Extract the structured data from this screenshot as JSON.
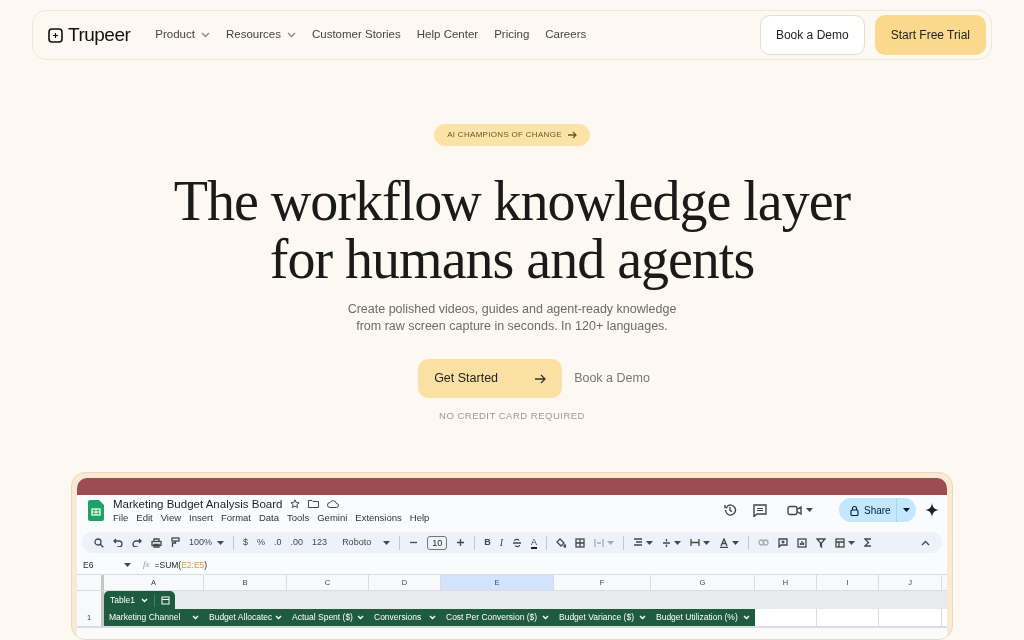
{
  "nav": {
    "logo": "Trupeer",
    "menu": [
      {
        "label": "Product",
        "dropdown": true
      },
      {
        "label": "Resources",
        "dropdown": true
      },
      {
        "label": "Customer Stories",
        "dropdown": false
      },
      {
        "label": "Help Center",
        "dropdown": false
      },
      {
        "label": "Pricing",
        "dropdown": false
      },
      {
        "label": "Careers",
        "dropdown": false
      }
    ],
    "demo_button": "Book a Demo",
    "trial_button": "Start Free Trial"
  },
  "hero": {
    "badge": "AI CHAMPIONS OF CHANGE",
    "headline": [
      "The workflow knowledge layer",
      "for humans and agents"
    ],
    "subtitle": [
      "Create polished videos, guides and agent-ready knowledge",
      "from raw screen capture in seconds. In 120+ languages."
    ],
    "primary_button": "Get Started",
    "secondary_link": "Book a Demo",
    "note": "NO CREDIT CARD REQUIRED"
  },
  "sheet": {
    "title": "Marketing Budget Analysis Board",
    "menus": [
      "File",
      "Edit",
      "View",
      "Insert",
      "Format",
      "Data",
      "Tools",
      "Gemini",
      "Extensions",
      "Help"
    ],
    "share": "Share",
    "toolbar": {
      "zoom": "100%",
      "currency": "$",
      "percent": "%",
      "dec_less": ".0",
      "dec_more": ".00",
      "number_format": "123",
      "font": "Roboto",
      "font_size": "10",
      "bold": "B",
      "italic": "I",
      "text_color": "A"
    },
    "cell_ref": "E6",
    "function_label": "fx",
    "formula": "=SUM(E2:E5)",
    "columns": [
      {
        "letter": "A",
        "selected": false
      },
      {
        "letter": "B",
        "selected": false
      },
      {
        "letter": "C",
        "selected": false
      },
      {
        "letter": "D",
        "selected": false
      },
      {
        "letter": "E",
        "selected": true
      },
      {
        "letter": "F",
        "selected": false
      },
      {
        "letter": "G",
        "selected": false
      },
      {
        "letter": "H",
        "selected": false
      },
      {
        "letter": "I",
        "selected": false
      },
      {
        "letter": "J",
        "selected": false
      }
    ],
    "table_name": "Table1",
    "row_number": "1",
    "headers": [
      "Marketing Channel",
      "Budget Allocatec",
      "Actual Spent ($)",
      "Conversions",
      "Cost Per Conversion ($)",
      "Budget Variance ($)",
      "Budget Utilization (%)"
    ]
  }
}
